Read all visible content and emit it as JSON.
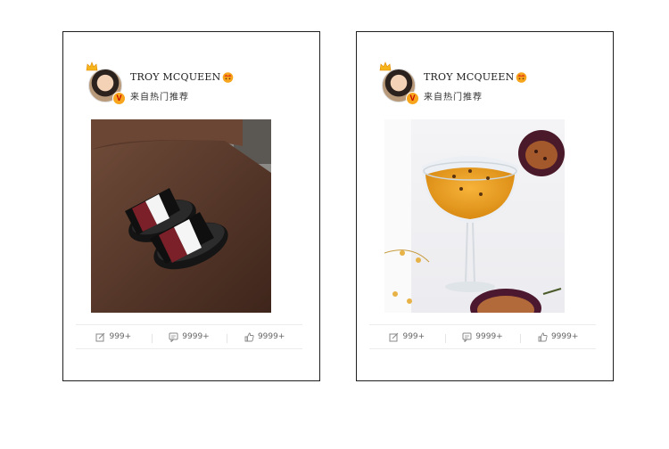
{
  "cards": [
    {
      "username": "TROY MCQUEEN",
      "subtitle": "来自热门推荐",
      "verified_badge": "V",
      "image": "slide-sandals",
      "stats": {
        "share": "999+",
        "comment": "9999+",
        "like": "9999+"
      }
    },
    {
      "username": "TROY MCQUEEN",
      "subtitle": "来自热门推荐",
      "verified_badge": "V",
      "image": "passion-fruit-cocktail",
      "stats": {
        "share": "999+",
        "comment": "9999+",
        "like": "9999+"
      }
    }
  ],
  "icons": {
    "share": "edit-share-icon",
    "comment": "comment-icon",
    "like": "thumbs-up-icon",
    "crown": "crown-icon",
    "verified": "verified-v-icon"
  },
  "colors": {
    "border": "#1f1f1f",
    "accent_orange": "#f7a51c",
    "verified_red": "#c40000",
    "text": "#222222",
    "stat_text": "#666666"
  }
}
